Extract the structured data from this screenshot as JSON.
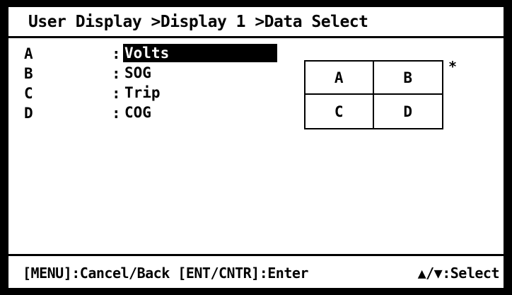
{
  "title": "User Display >Display 1 >Data Select",
  "rows": [
    {
      "key": "A",
      "sep": ":",
      "value": "Volts",
      "selected": true
    },
    {
      "key": "B",
      "sep": ":",
      "value": "SOG",
      "selected": false
    },
    {
      "key": "C",
      "sep": ":",
      "value": "Trip",
      "selected": false
    },
    {
      "key": "D",
      "sep": ":",
      "value": "COG",
      "selected": false
    }
  ],
  "layout_grid": {
    "cells": [
      "A",
      "B",
      "C",
      "D"
    ],
    "marker": "*"
  },
  "footer": {
    "left": "[MENU]:Cancel/Back [ENT/CNTR]:Enter",
    "right": "▲/▼:Select"
  },
  "colors": {
    "background": "#000000",
    "panel": "#ffffff",
    "text": "#000000",
    "highlight_bg": "#000000",
    "highlight_text": "#ffffff"
  }
}
